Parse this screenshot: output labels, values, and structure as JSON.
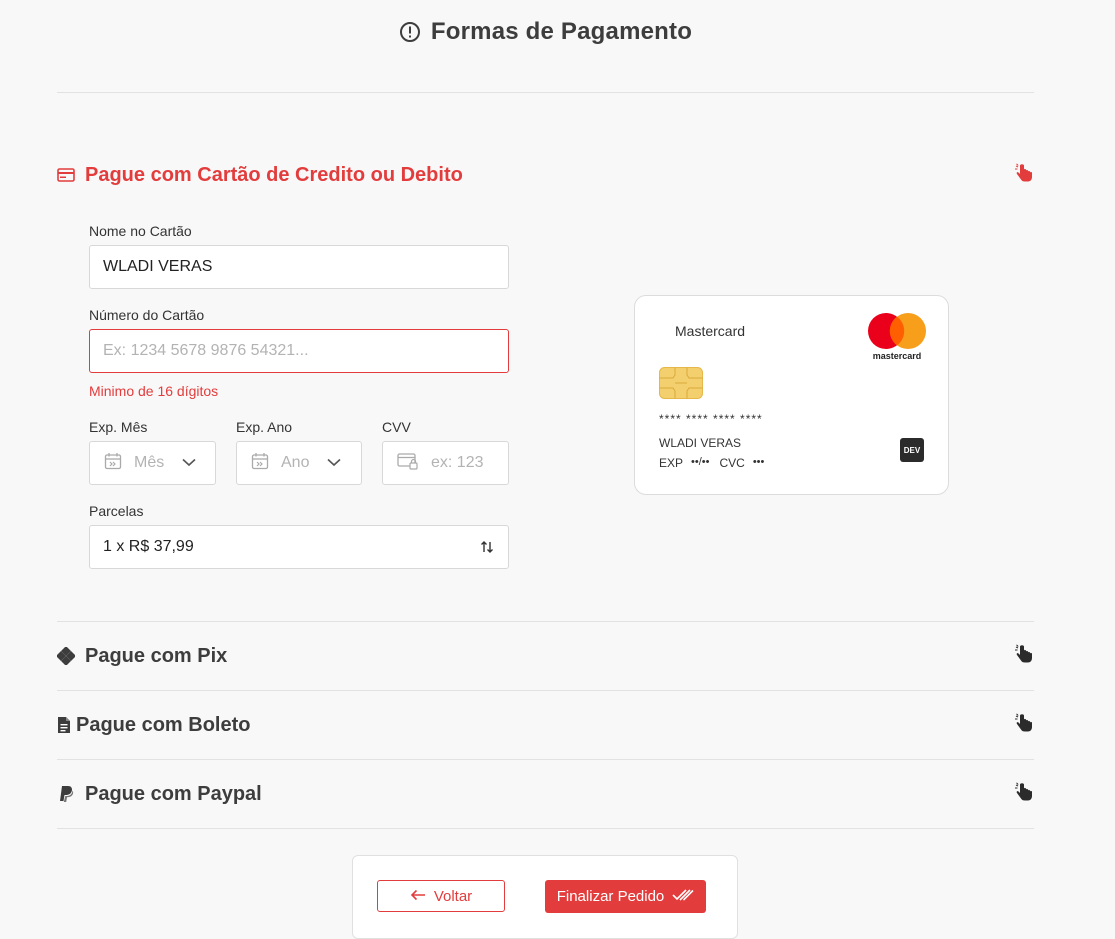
{
  "page": {
    "title": "Formas de Pagamento"
  },
  "sections": {
    "card": {
      "label": "Pague com Cartão de Credito ou Debito"
    },
    "pix": {
      "label": "Pague com Pix"
    },
    "boleto": {
      "label": "Pague com Boleto"
    },
    "paypal": {
      "label": "Pague com Paypal"
    }
  },
  "form": {
    "name_label": "Nome no Cartão",
    "name_value": "WLADI VERAS",
    "number_label": "Número do Cartão",
    "number_placeholder": "Ex: 1234 5678 9876 54321...",
    "number_error": "Minimo de 16 dígitos",
    "month_label": "Exp. Mês",
    "month_placeholder": "Mês",
    "year_label": "Exp. Ano",
    "year_placeholder": "Ano",
    "cvv_label": "CVV",
    "cvv_placeholder": "ex: 123",
    "installments_label": "Parcelas",
    "installments_value": "1 x R$ 37,99"
  },
  "card_preview": {
    "brand": "Mastercard",
    "logo_text": "mastercard",
    "number": "**** **** **** ****",
    "holder": "WLADI VERAS",
    "exp_label": "EXP",
    "exp_value": "••/••",
    "cvc_label": "CVC",
    "cvc_value": "•••",
    "badge": "DEV"
  },
  "footer": {
    "back_label": "Voltar",
    "finish_label": "Finalizar Pedido"
  },
  "colors": {
    "accent": "#e33c3c",
    "text": "#3d3d3d",
    "background": "#f8f8f8"
  }
}
